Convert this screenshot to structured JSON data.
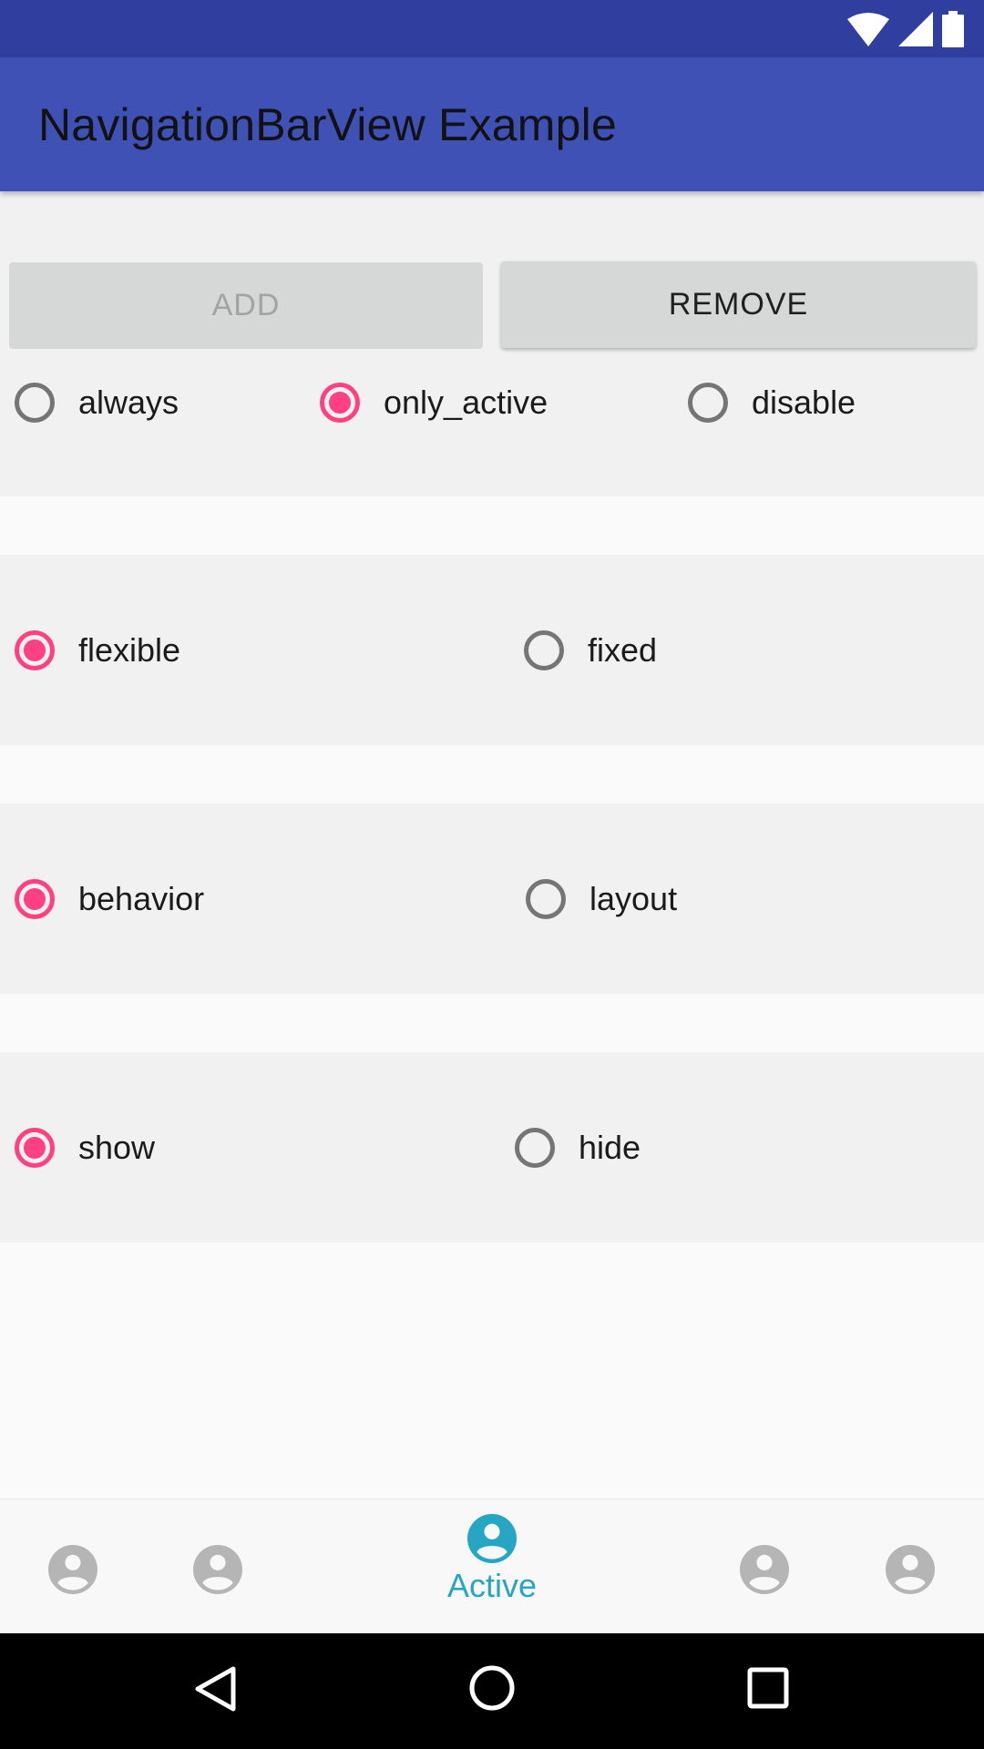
{
  "app_bar": {
    "title": "NavigationBarView Example"
  },
  "buttons": {
    "add": "ADD",
    "remove": "REMOVE"
  },
  "label_visibility": {
    "options": [
      "always",
      "only_active",
      "disable"
    ],
    "selected": "only_active"
  },
  "mode": {
    "options": [
      "flexible",
      "fixed"
    ],
    "selected": "flexible"
  },
  "scroll": {
    "options": [
      "behavior",
      "layout"
    ],
    "selected": "behavior"
  },
  "visibility": {
    "options": [
      "show",
      "hide"
    ],
    "selected": "show"
  },
  "bottom_nav": {
    "items": [
      {
        "icon": "account-circle-icon",
        "label": "",
        "active": false
      },
      {
        "icon": "account-circle-icon",
        "label": "",
        "active": false
      },
      {
        "icon": "account-circle-icon",
        "label": "Active",
        "active": true
      },
      {
        "icon": "account-circle-icon",
        "label": "",
        "active": false
      },
      {
        "icon": "account-circle-icon",
        "label": "",
        "active": false
      }
    ]
  },
  "status_bar": {
    "icons": [
      "wifi-icon",
      "signal-icon",
      "battery-icon"
    ]
  },
  "system_nav": {
    "icons": [
      "back-icon",
      "home-icon",
      "recents-icon"
    ]
  },
  "colors": {
    "primary": "#3f51b5",
    "primary_dark": "#303f9f",
    "accent": "#ff4081",
    "active_nav": "#26a6c2",
    "inactive_nav": "#b5b5b5"
  }
}
